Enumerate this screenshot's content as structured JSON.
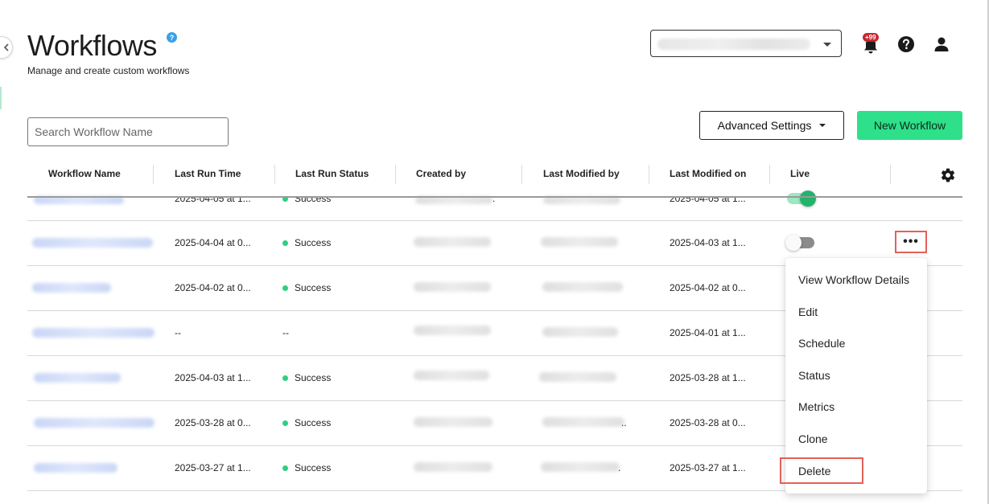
{
  "page": {
    "title": "Workflows",
    "help_badge": "?",
    "subtitle": "Manage and create custom workflows"
  },
  "topbar": {
    "notification_count": "+99"
  },
  "toolbar": {
    "search_placeholder": "Search Workflow Name",
    "advanced_settings_label": "Advanced Settings",
    "new_workflow_label": "New Workflow"
  },
  "table": {
    "columns": [
      "Workflow Name",
      "Last Run Time",
      "Last Run Status",
      "Created by",
      "Last Modified by",
      "Last Modified on",
      "Live"
    ],
    "rows": [
      {
        "last_run_time": "2025-04-05 at 1...",
        "status": "Success",
        "created_suffix": ".",
        "modified_by_suffix": "",
        "last_modified_on": "2025-04-05 at 1...",
        "live": true
      },
      {
        "last_run_time": "2025-04-04 at 0...",
        "status": "Success",
        "created_suffix": "",
        "modified_by_suffix": "",
        "last_modified_on": "2025-04-03 at 1...",
        "live": false
      },
      {
        "last_run_time": "2025-04-02 at 0...",
        "status": "Success",
        "created_suffix": "",
        "modified_by_suffix": "",
        "last_modified_on": "2025-04-02 at 0...",
        "live": null
      },
      {
        "last_run_time": "--",
        "status": "--",
        "created_suffix": "",
        "modified_by_suffix": "",
        "last_modified_on": "2025-04-01 at 1...",
        "live": null
      },
      {
        "last_run_time": "2025-04-03 at 1...",
        "status": "Success",
        "created_suffix": "",
        "modified_by_suffix": "",
        "last_modified_on": "2025-03-28 at 1...",
        "live": null
      },
      {
        "last_run_time": "2025-03-28 at 0...",
        "status": "Success",
        "created_suffix": "",
        "modified_by_suffix": "..",
        "last_modified_on": "2025-03-28 at 0...",
        "live": null
      },
      {
        "last_run_time": "2025-03-27 at 1...",
        "status": "Success",
        "created_suffix": "",
        "modified_by_suffix": ".",
        "last_modified_on": "2025-03-27 at 1...",
        "live": null
      }
    ]
  },
  "row_menu": {
    "more_label": "•••",
    "items": [
      "View Workflow Details",
      "Edit",
      "Schedule",
      "Status",
      "Metrics",
      "Clone",
      "Delete"
    ]
  },
  "colors": {
    "accent_green": "#2ee08a",
    "success_dot": "#2ecf7f",
    "highlight_red": "#e4605a",
    "notification_red": "#c62830"
  }
}
